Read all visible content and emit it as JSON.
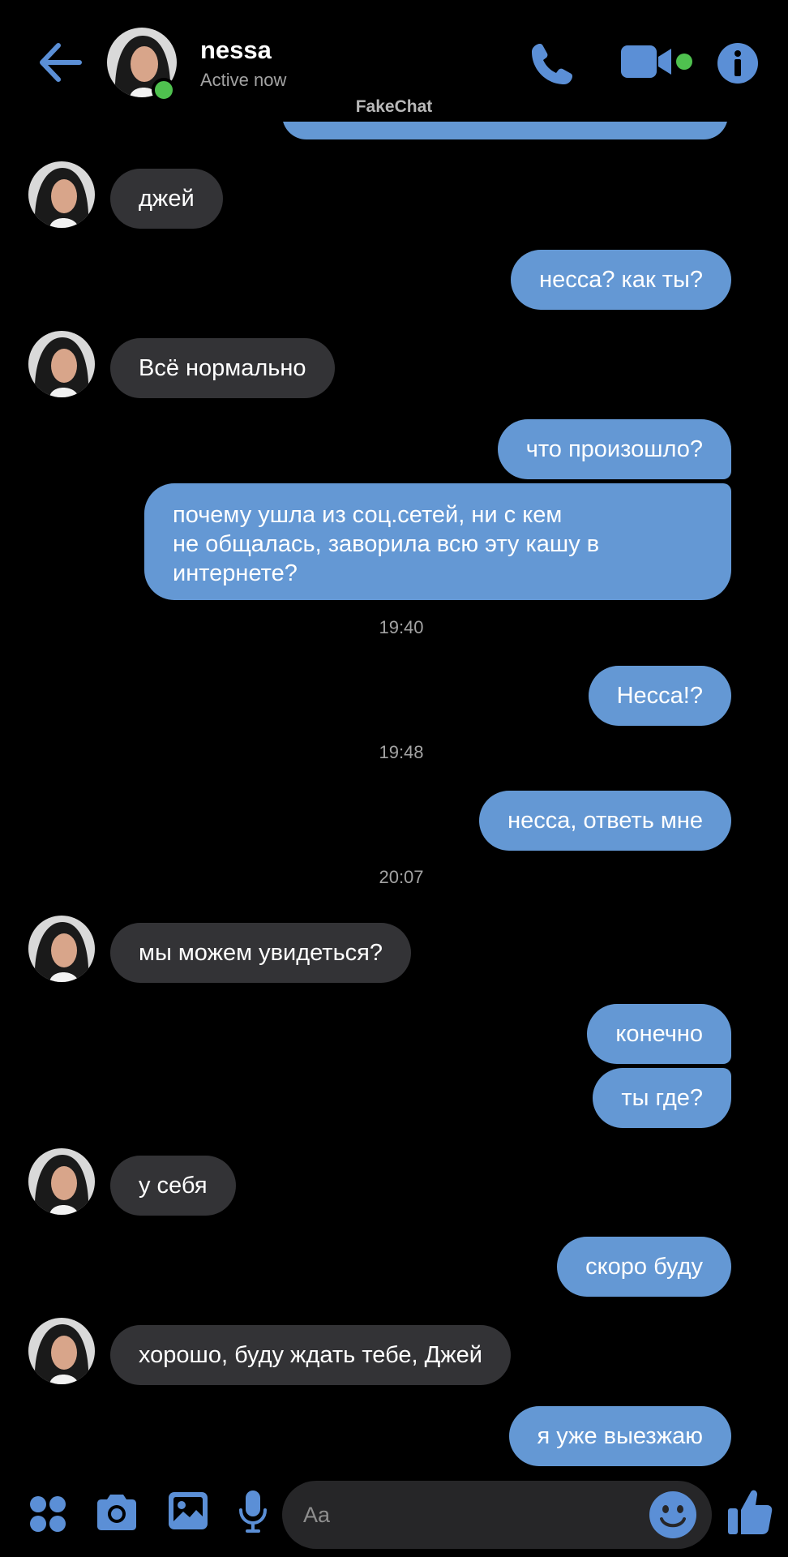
{
  "header": {
    "contact_name": "nessa",
    "status": "Active now",
    "watermark": "FakeChat"
  },
  "messages": [
    {
      "direction": "incoming",
      "text": "джей"
    },
    {
      "direction": "outgoing",
      "text": "несса? как ты?"
    },
    {
      "direction": "incoming",
      "text": "Всё нормально"
    },
    {
      "direction": "outgoing",
      "text": "что произошло?"
    },
    {
      "direction": "outgoing",
      "lines": [
        "почему ушла из соц.сетей,  ни с кем",
        "не общалась, заворила всю эту кашу в",
        "интернете?"
      ]
    },
    {
      "direction": "outgoing",
      "text": "Несса!?"
    },
    {
      "direction": "outgoing",
      "text": "несса, ответь мне"
    },
    {
      "direction": "incoming",
      "text": "мы можем увидеться?"
    },
    {
      "direction": "outgoing",
      "text": "конечно"
    },
    {
      "direction": "outgoing",
      "text": "ты где?"
    },
    {
      "direction": "incoming",
      "text": "у себя"
    },
    {
      "direction": "outgoing",
      "text": "скоро буду"
    },
    {
      "direction": "incoming",
      "text": "хорошо, буду ждать тебе, Джей"
    },
    {
      "direction": "outgoing",
      "text": "я уже выезжаю"
    }
  ],
  "timestamps": [
    "19:40",
    "19:48",
    "20:07"
  ],
  "composer": {
    "placeholder": "Aa"
  },
  "colors": {
    "outgoing_bubble": "#6498d4",
    "incoming_bubble": "#333336",
    "accent": "#5b8fd6",
    "online": "#4fc14f"
  },
  "icons": [
    "back-arrow-icon",
    "phone-icon",
    "video-camera-icon",
    "info-icon",
    "apps-icon",
    "camera-icon",
    "image-icon",
    "microphone-icon",
    "emoji-icon",
    "thumbs-up-icon"
  ]
}
